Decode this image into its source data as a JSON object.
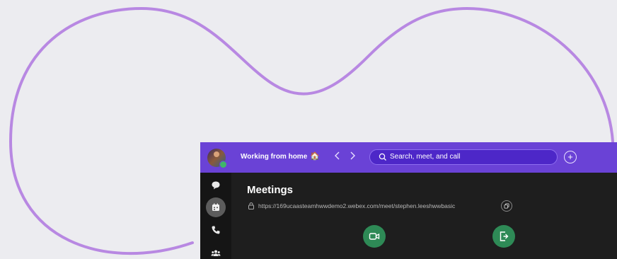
{
  "colors": {
    "background": "#ececf0",
    "decor_curve": "#b888e2",
    "topbar": "#6a42d6",
    "accent_green": "#2e8a56"
  },
  "topbar": {
    "status_text": "Working from home",
    "status_emoji": "🏠",
    "back_icon": "chevron-left-icon",
    "forward_icon": "chevron-right-icon",
    "search_placeholder": "Search, meet, and call",
    "add_icon": "plus-circle-icon"
  },
  "sidebar": {
    "items": [
      {
        "name": "messaging",
        "icon": "chat-bubble-icon",
        "active": false
      },
      {
        "name": "meetings",
        "icon": "calendar-icon",
        "active": true
      },
      {
        "name": "calling",
        "icon": "phone-icon",
        "active": false
      },
      {
        "name": "contacts",
        "icon": "people-icon",
        "active": false
      }
    ]
  },
  "main": {
    "title": "Meetings",
    "personal_room_url": "https://169ucaasteamhwwdemo2.webex.com/meet/stephen.leeshwwbasic",
    "actions": [
      {
        "name": "start-meeting",
        "icon": "video-camera-icon"
      },
      {
        "name": "join-meeting",
        "icon": "join-door-icon"
      }
    ]
  }
}
